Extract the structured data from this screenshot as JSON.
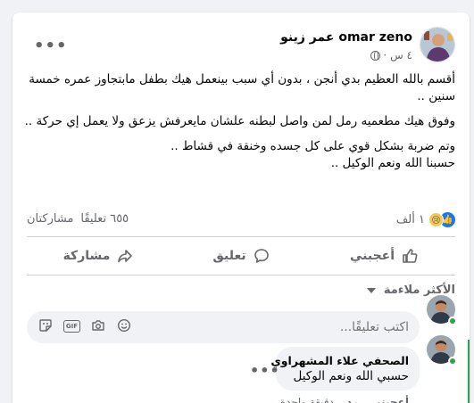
{
  "post": {
    "author": "omar zeno عمر زينو",
    "time": "٤ س",
    "paragraphs": [
      "أقسم بالله العظيم بدي أنجن ، بدون أي سبب بينعمل هيك بطفل مابتجاوز عمره خمسة سنين ..",
      "وفوق هيك مطعميه رمل لمن واصل لبطنه علشان مايعرفش يزعق ولا يعمل إي حركة ..",
      "وتم ضربة بشكل قوي على كل جسده وخنقة في قشاط ..\nحسبنا الله ونعم الوكيل .."
    ],
    "reactions_count": "١ ألف",
    "comments_count": "٦٥٥ تعليقًا",
    "shares": "مشاركتان",
    "reaction_icons": [
      "like-icon",
      "sad-icon"
    ]
  },
  "actions": {
    "like": "أعجبني",
    "comment": "تعليق",
    "share": "مشاركة"
  },
  "comments": {
    "sort_label": "الأكثر ملاءمة",
    "composer_placeholder": "اكتب تعليقًا...",
    "items": [
      {
        "name": "الصحفي علاء المشهراوي",
        "text": "حسبي الله ونعم الوكيل",
        "like": "أعجبني",
        "reply": "رد",
        "time": "دقيقة واحدة"
      }
    ]
  },
  "colors": {
    "accent": "#1877f2",
    "online": "#31a24c",
    "muted": "#65676b"
  }
}
